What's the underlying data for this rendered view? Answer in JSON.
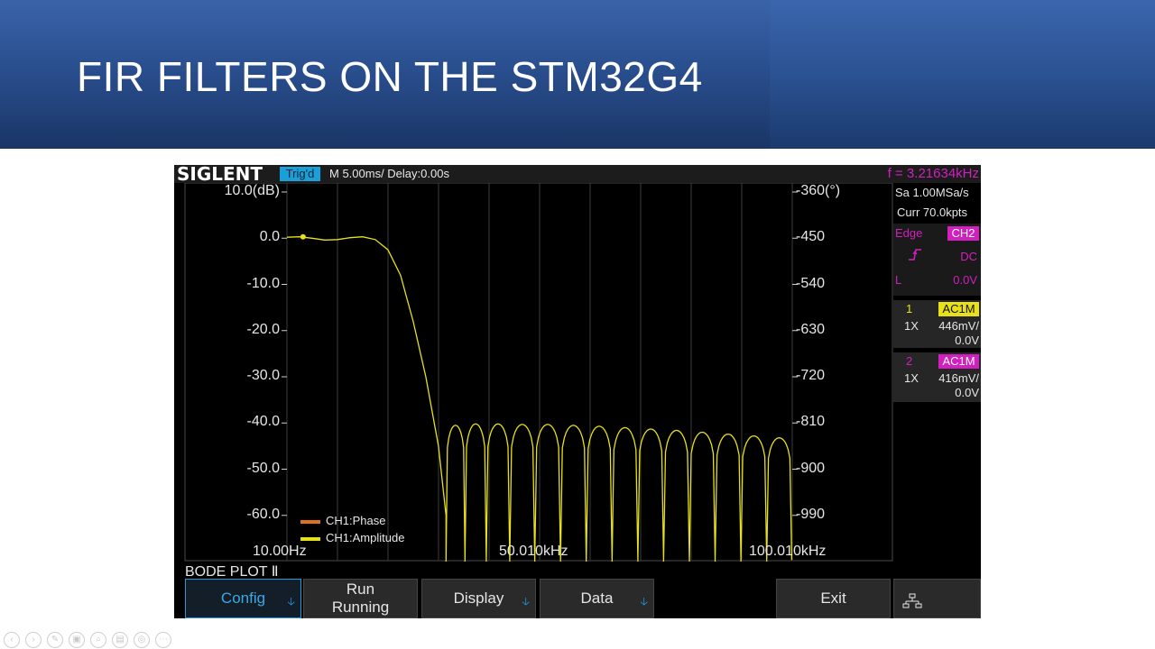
{
  "slide": {
    "title": "FIR FILTERS ON THE STM32G4"
  },
  "scope": {
    "brand": "SIGLENT",
    "trigger_status": "Trig'd",
    "timebase": "M 5.00ms/ Delay:0.00s",
    "frequency": "f = 3.21634kHz",
    "sample_rate": "Sa 1.00MSa/s",
    "curr_points": "Curr 70.0kpts",
    "trigger": {
      "type": "Edge",
      "source": "CH2",
      "slope_icon": "rising-edge-icon",
      "coupling": "DC",
      "level_label": "L",
      "level": "0.0V"
    },
    "channels": [
      {
        "number": "1",
        "coupling": "AC1M",
        "probe": "1X",
        "scale": "446mV/",
        "offset": "0.0V",
        "color": "#e8e01a"
      },
      {
        "number": "2",
        "coupling": "AC1M",
        "probe": "1X",
        "scale": "416mV/",
        "offset": "0.0V",
        "color": "#d21fc0"
      }
    ],
    "mode_label": "BODE PLOT Ⅱ",
    "menu": [
      {
        "label": "Config",
        "active": true,
        "has_arrow": true
      },
      {
        "label": "Run\nRunning",
        "active": false,
        "has_arrow": false
      },
      {
        "label": "Display",
        "active": false,
        "has_arrow": true
      },
      {
        "label": "Data",
        "active": false,
        "has_arrow": true
      },
      {
        "label": "Exit",
        "active": false,
        "has_arrow": false
      },
      {
        "label": "",
        "icon": "network-icon"
      }
    ],
    "colors": {
      "amplitude": "#e8e01a",
      "phase": "#e07020",
      "trigger": "#d21fc0",
      "accent": "#1aa0d8"
    }
  },
  "chart_data": {
    "type": "line",
    "title": "",
    "left_axis_label": "10.0(dB)",
    "right_axis_label": "-360(°)",
    "y_ticks": [
      "10.0(dB)",
      "0.0",
      "-10.0",
      "-20.0",
      "-30.0",
      "-40.0",
      "-50.0",
      "-60.0"
    ],
    "y_tick_values": [
      10,
      0,
      -10,
      -20,
      -30,
      -40,
      -50,
      -60
    ],
    "phase_ticks": [
      "-360(°)",
      "-450",
      "-540",
      "-630",
      "-720",
      "-810",
      "-900",
      "-990"
    ],
    "x_ticks": [
      "10.00Hz",
      "50.010kHz",
      "100.010kHz"
    ],
    "ylim": [
      -70,
      10
    ],
    "xlim_kHz": [
      0.01,
      100.01
    ],
    "grid": true,
    "legend": [
      "CH1:Phase",
      "CH1:Amplitude"
    ],
    "legend_position": "bottom-left",
    "series": [
      {
        "name": "CH1:Amplitude",
        "x_kHz": [
          0.01,
          2.5,
          5,
          7.5,
          10,
          12.5,
          15,
          17.5,
          20,
          22.5,
          25,
          27.5,
          30,
          31.5
        ],
        "y_dB": [
          0.2,
          0.3,
          0.0,
          -0.4,
          -0.3,
          0.1,
          0.3,
          -0.3,
          -2.5,
          -8,
          -18,
          -30,
          -45,
          -60
        ],
        "stopband_lobes_kHz": [
          33.3,
          37.2,
          41.7,
          46.5,
          51.6,
          56.7,
          61.8,
          66.9,
          72.0,
          77.1,
          82.2,
          87.3,
          92.4,
          97.5
        ],
        "stopband_peaks_dB": [
          -40.5,
          -40.2,
          -40.2,
          -40.3,
          -40.3,
          -40.5,
          -40.7,
          -41.0,
          -41.3,
          -41.6,
          -42.0,
          -42.4,
          -42.8,
          -43.2
        ],
        "nulls_dB": -70
      },
      {
        "name": "CH1:Phase",
        "x_kHz": [],
        "y_deg": []
      }
    ],
    "cursor_marker": {
      "x_kHz": 3.2,
      "y_dB": 0.3
    }
  }
}
